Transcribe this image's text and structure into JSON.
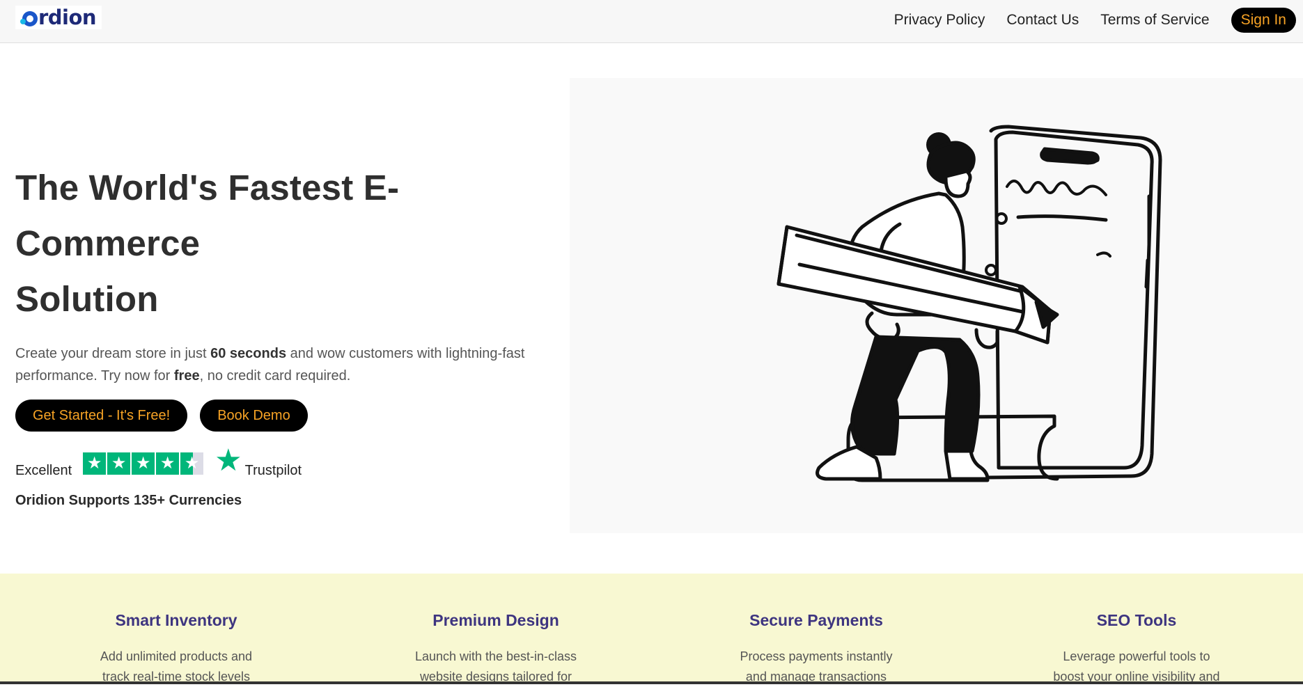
{
  "brand": {
    "name": "rdion"
  },
  "nav": {
    "links": [
      "Privacy Policy",
      "Contact Us",
      "Terms of Service"
    ],
    "signin": "Sign In"
  },
  "hero": {
    "title_line1": "The World's Fastest E-Commerce",
    "title_line2": "Solution",
    "sub_a": "Create your dream store in just ",
    "sub_b": "60 seconds",
    "sub_c": " and wow customers with lightning-fast performance. Try now for ",
    "sub_d": "free",
    "sub_e": ", no credit card required.",
    "cta_primary": "Get Started - It's Free!",
    "cta_secondary": "Book Demo",
    "rating_word": "Excellent",
    "rating_stars": 4.5,
    "trustpilot": "Trustpilot",
    "currencies": "Oridion Supports 135+ Currencies"
  },
  "features": [
    {
      "title": "Smart Inventory",
      "desc_1": "Add unlimited products and",
      "desc_2": "track real-time stock levels"
    },
    {
      "title": "Premium Design",
      "desc_1": "Launch with the best-in-class",
      "desc_2": "website designs tailored for"
    },
    {
      "title": "Secure Payments",
      "desc_1": "Process payments instantly",
      "desc_2": "and manage transactions"
    },
    {
      "title": "SEO Tools",
      "desc_1": "Leverage powerful tools to",
      "desc_2": "boost your online visibility and"
    }
  ],
  "colors": {
    "accent_orange": "#f7a325",
    "trust_green": "#00b67a",
    "feature_title": "#3e3580",
    "feature_band": "#f8f8d2"
  }
}
